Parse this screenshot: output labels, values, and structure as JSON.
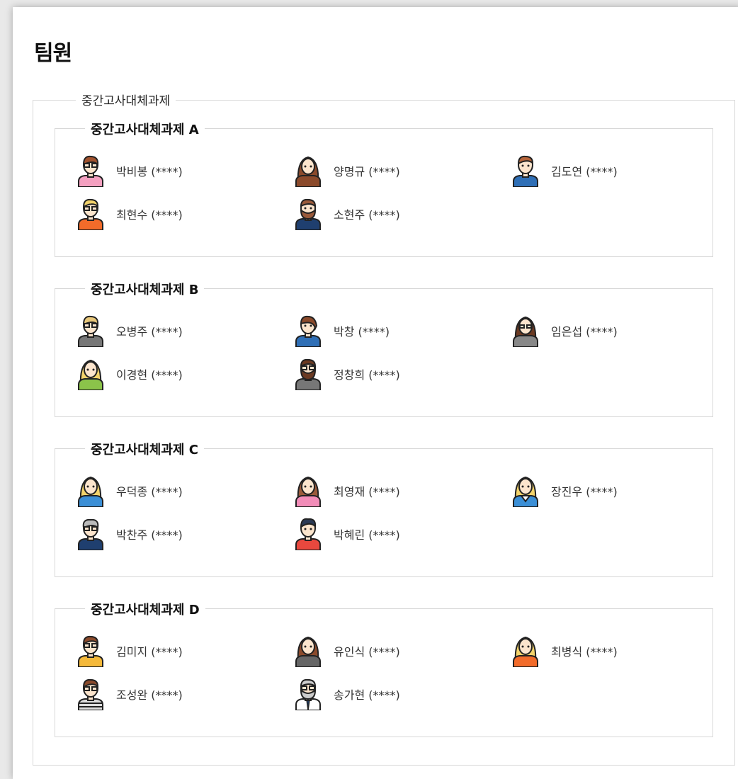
{
  "page": {
    "title": "팀원"
  },
  "group": {
    "title": "중간고사대체과제",
    "subgroups": [
      {
        "title": "중간고사대체과제 A",
        "members": [
          {
            "name": "박비봉 (****)",
            "avatar": "person-avatar-glasses-pink-shirt"
          },
          {
            "name": "양명규 (****)",
            "avatar": "person-avatar-long-brown-hair"
          },
          {
            "name": "김도연 (****)",
            "avatar": "person-avatar-blue-shirt"
          },
          {
            "name": "최현수 (****)",
            "avatar": "person-avatar-blond-glasses-orange"
          },
          {
            "name": "소현주 (****)",
            "avatar": "person-avatar-bearded-navy"
          }
        ]
      },
      {
        "title": "중간고사대체과제 B",
        "members": [
          {
            "name": "오병주 (****)",
            "avatar": "person-avatar-glasses-gray-jacket"
          },
          {
            "name": "박창 (****)",
            "avatar": "person-avatar-ponytail-blue"
          },
          {
            "name": "임은섭 (****)",
            "avatar": "person-avatar-long-hair-glasses-gray"
          },
          {
            "name": "이경현 (****)",
            "avatar": "person-avatar-blond-green-top"
          },
          {
            "name": "정창희 (****)",
            "avatar": "person-avatar-bearded-glasses-gray"
          }
        ]
      },
      {
        "title": "중간고사대체과제 C",
        "members": [
          {
            "name": "우덕종 (****)",
            "avatar": "person-avatar-blond-long-blue"
          },
          {
            "name": "최영재 (****)",
            "avatar": "person-avatar-brown-hair-pink"
          },
          {
            "name": "장진우 (****)",
            "avatar": "person-avatar-blond-white-collar"
          },
          {
            "name": "박찬주 (****)",
            "avatar": "person-avatar-gray-hair-navy"
          },
          {
            "name": "박혜린 (****)",
            "avatar": "person-avatar-dark-hair-red"
          }
        ]
      },
      {
        "title": "중간고사대체과제 D",
        "members": [
          {
            "name": "김미지 (****)",
            "avatar": "person-avatar-glasses-yellow"
          },
          {
            "name": "유인식 (****)",
            "avatar": "person-avatar-long-hair-gray"
          },
          {
            "name": "최병식 (****)",
            "avatar": "person-avatar-blond-orange-top"
          },
          {
            "name": "조성완 (****)",
            "avatar": "person-avatar-glasses-striped"
          },
          {
            "name": "송가현 (****)",
            "avatar": "person-avatar-old-man-tie"
          }
        ]
      }
    ]
  },
  "colors": {
    "border": "#d8d8d8",
    "skin": "#fce5cd",
    "outline": "#222222"
  }
}
